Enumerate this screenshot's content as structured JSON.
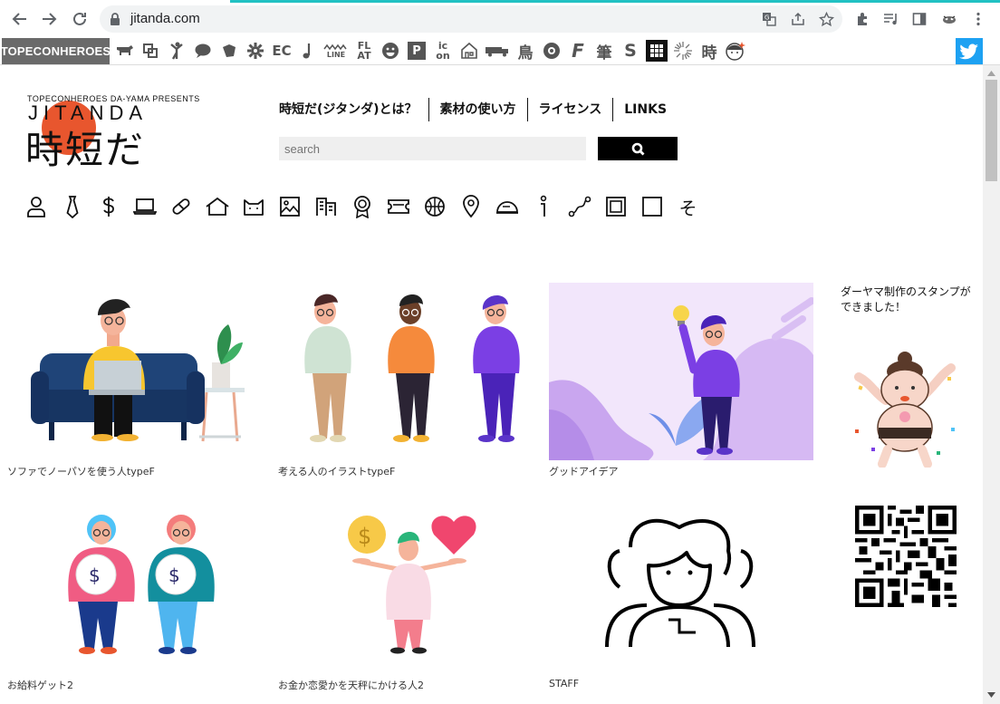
{
  "browser": {
    "url": "jitanda.com"
  },
  "site_bar": {
    "brand": "TOPECONHEROES",
    "icons": [
      "cow-icon",
      "copy-icon",
      "person-icon",
      "bubble-icon",
      "tag-icon",
      "gear-icon",
      "EC",
      "note-icon",
      "LINE",
      "FLAT",
      "smile-icon",
      "P",
      "icon",
      "house-icon",
      "truck-icon",
      "鳥",
      "flower-icon",
      "F",
      "筆",
      "S",
      "grid-icon",
      "burst-icon",
      "時",
      "face-icon"
    ],
    "ec_label": "EC",
    "line_label": "LINE",
    "flat_label1": "FL",
    "flat_label2": "AT",
    "p_label": "P",
    "icon_label1": "ic",
    "icon_label2": "on",
    "bird_label": "鳥",
    "f_label": "F",
    "brush_label": "筆",
    "s_label": "S",
    "time_label": "時"
  },
  "header": {
    "logo_presents": "TOPECONHEROES DA-YAMA PRESENTS",
    "logo_title": "JITANDA",
    "logo_kanji": "時短だ",
    "menu": [
      "時短だ(ジタンダ)とは？",
      "素材の使い方",
      "ライセンス",
      "LINKS"
    ],
    "search_placeholder": "search"
  },
  "categories": [
    "person-icon",
    "tie-icon",
    "dollar-icon",
    "laptop-icon",
    "pill-icon",
    "house-icon",
    "cat-icon",
    "image-icon",
    "building-icon",
    "award-icon",
    "ticket-icon",
    "basketball-icon",
    "map-pin-icon",
    "helmet-icon",
    "info-icon",
    "route-icon",
    "frame-icon",
    "square-icon",
    "other-icon"
  ],
  "category_last_label": "そ",
  "items": [
    {
      "caption": "ソファでノーパソを使う人typeF"
    },
    {
      "caption": "考える人のイラストtypeF"
    },
    {
      "caption": "グッドアイデア"
    },
    {
      "caption": "お給料ゲット2"
    },
    {
      "caption": "お金か恋愛かを天秤にかける人2"
    },
    {
      "caption": "STAFF"
    }
  ],
  "sidebar": {
    "stamp_text": "ダーヤマ制作のスタンプができました！"
  },
  "colors": {
    "accent": "#22c1c3",
    "brand_bg": "#6a6a6a",
    "twitter": "#1da1f2",
    "logo_sun": "#e8562e",
    "purple": "#7b3fe4",
    "orange": "#f58a3c"
  }
}
